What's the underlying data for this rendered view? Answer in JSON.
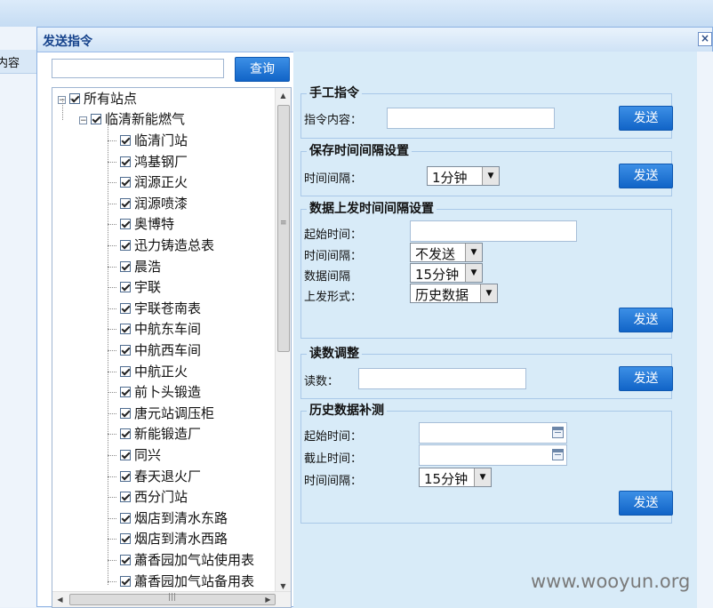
{
  "background": {
    "left_tab_text": "内容"
  },
  "dialog": {
    "title": "发送指令",
    "close_glyph": "×"
  },
  "search": {
    "placeholder": "",
    "button_label": "查询"
  },
  "tree": {
    "root": "所有站点",
    "group": "临清新能燃气",
    "stations": [
      "临清门站",
      "鸿基钢厂",
      "润源正火",
      "润源喷漆",
      "奥博特",
      "迅力铸造总表",
      "晨浩",
      "宇联",
      "宇联苍南表",
      "中航东车间",
      "中航西车间",
      "中航正火",
      "前卜头锻造",
      "唐元站调压柜",
      "新能锻造厂",
      "同兴",
      "春天退火厂",
      "西分门站",
      "烟店到清水东路",
      "烟店到清水西路",
      "蕭香园加气站使用表",
      "蕭香园加气站备用表"
    ]
  },
  "sections": {
    "manual": {
      "title": "手工指令",
      "content_label": "指令内容：",
      "content_value": "",
      "send": "发送"
    },
    "save_interval": {
      "title": "保存时间间隔设置",
      "interval_label": "时间间隔：",
      "interval_value": "1分钟",
      "send": "发送"
    },
    "upload_interval": {
      "title": "数据上发时间间隔设置",
      "start_label": "起始时间：",
      "start_value": "",
      "interval_label": "时间间隔：",
      "interval_value": "不发送",
      "data_interval_label": "数据间隔",
      "data_interval_value": "15分钟",
      "mode_label": "上发形式：",
      "mode_value": "历史数据",
      "send": "发送"
    },
    "reading": {
      "title": "读数调整",
      "reading_label": "读数：",
      "reading_value": "",
      "send": "发送"
    },
    "history": {
      "title": "历史数据补测",
      "start_label": "起始时间：",
      "start_value": "",
      "end_label": "截止时间：",
      "end_value": "",
      "interval_label": "时间间隔：",
      "interval_value": "15分钟",
      "send": "发送"
    }
  },
  "watermark": "www.wooyun.org",
  "colors": {
    "button": "#1a73d6",
    "panel": "#d8ebf8",
    "title_text": "#15428b"
  }
}
